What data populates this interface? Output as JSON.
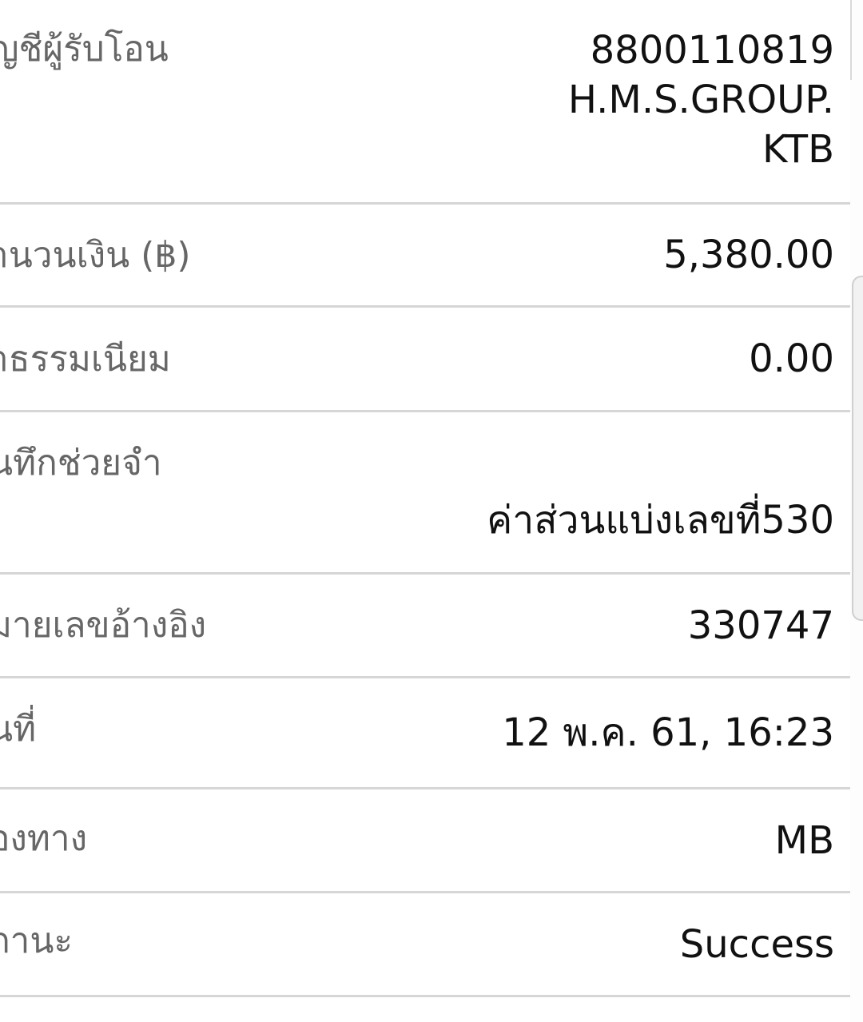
{
  "rows": {
    "recipient": {
      "label": "ญชีผู้รับโอน",
      "account_number": "8800110819",
      "account_name": "H.M.S.GROUP.",
      "bank": "KTB"
    },
    "amount": {
      "label": "านวนเงิน (฿)",
      "value": "5,380.00"
    },
    "fee": {
      "label": "่าธรรมเนียม",
      "value": "0.00"
    },
    "memo": {
      "label": "นทึกช่วยจำ",
      "value": "ค่าส่วนแบ่งเลขที่530"
    },
    "reference": {
      "label": "มายเลขอ้างอิง",
      "value": "330747"
    },
    "date": {
      "label": "นที่",
      "value": "12 พ.ค. 61, 16:23"
    },
    "channel": {
      "label": "่องทาง",
      "value": "MB"
    },
    "status": {
      "label": "ถานะ",
      "value": "Success"
    }
  }
}
